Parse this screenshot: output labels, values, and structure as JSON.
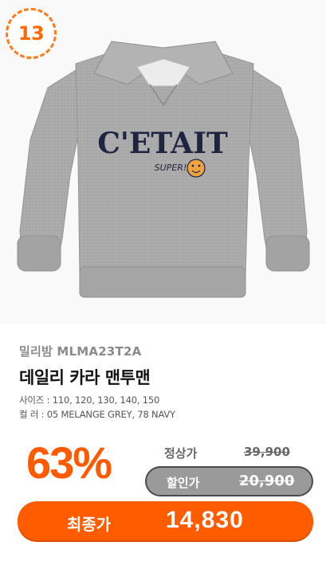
{
  "badge": {
    "rank": "13"
  },
  "product": {
    "brand": "밀리밤 MLMA23T2A",
    "title": "데일리 카라 맨투맨",
    "size_line": "사이즈 : 110, 120, 130, 140, 150",
    "color_line": "컬    러 : 05 MELANGE GREY, 78 NAVY",
    "print_text_1": "C'ETAIT",
    "print_text_2": "SUPER!"
  },
  "pricing": {
    "discount": "63%",
    "regular_label": "정상가",
    "regular_price": "39,900",
    "sale_label": "할인가",
    "sale_price": "20,900",
    "final_label": "최종가",
    "final_price": "14,830"
  },
  "colors": {
    "accent": "#ff5c00",
    "sweater_grey": "#a9a9a9",
    "navy_print": "#1f2440"
  }
}
